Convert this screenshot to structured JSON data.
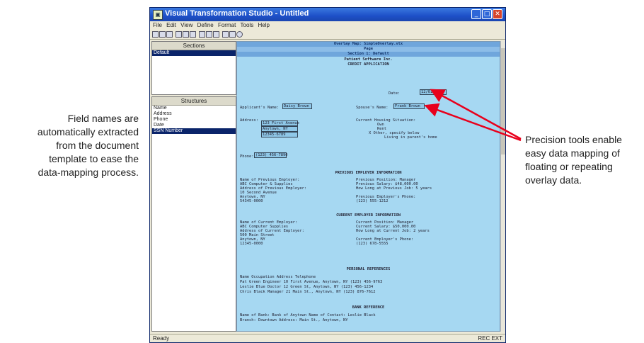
{
  "callouts": {
    "left": [
      "Field names are",
      "automatically extracted",
      "from the document",
      "template to ease the",
      "data-mapping process."
    ],
    "right": [
      "Precision tools enable",
      "easy data mapping of",
      "floating or repeating",
      "overlay data."
    ]
  },
  "window": {
    "title": "Visual Transformation Studio - Untitled",
    "menu": [
      "File",
      "Edit",
      "View",
      "Define",
      "Format",
      "Tools",
      "Help"
    ],
    "status_left": "Ready",
    "status_right": "REC  EXT"
  },
  "sections_pane": {
    "header": "Sections",
    "items": [
      "Default"
    ]
  },
  "structures_pane": {
    "header": "Structures",
    "items": [
      "Name",
      "Address",
      "Phone",
      "Date",
      "SSN Number"
    ],
    "selected": 4
  },
  "doc": {
    "headers": [
      "Overlay Map: SimpleOverlay.vtx",
      "Page",
      "Section 1: Default"
    ],
    "company": "Patient Software Inc.",
    "form_title": "CREDIT APPLICATION",
    "date_label": "Date:",
    "date_value": "12/01/2000",
    "applicant_label": "Applicant's Name:",
    "applicant_value": "Daisy Brown",
    "spouse_label": "Spouse's Name:",
    "spouse_value": "Frank Brown",
    "address_label": "Address:",
    "address_lines": [
      "123 First Avenue",
      "Anytown, NY",
      "12345-6789"
    ],
    "housing_label": "Current Housing Situation:",
    "housing_options": [
      "Own",
      "Rent",
      "X  Other, specify below",
      "Living in parent's home"
    ],
    "phone_label": "Phone:",
    "phone_value": "(123) 456-7890",
    "previous_title": "PREVIOUS EMPLOYER INFORMATION",
    "previous_left": [
      "Name of Previous Employer:",
      "   ABC Computer & Supplies",
      "Address of Previous Employer:",
      "   10 Second Avenue",
      "   Anytown, NY",
      "   54345-0000"
    ],
    "previous_right": [
      "Previous Position:       Manager",
      "Previous Salary:        $48,000.00",
      "How Long at Previous Job: 5 years",
      "",
      "Previous Employer's Phone:",
      "   (123) 555-1212"
    ],
    "current_title": "CURRENT EMPLOYER INFORMATION",
    "current_left": [
      "Name of Current Employer:",
      "   ABC Computer Supplies",
      "Address of Current Employer:",
      "   500 Main Street",
      "   Anytown, NY",
      "   12345-0000"
    ],
    "current_right": [
      "Current Position:         Manager",
      "Current Salary:        $50,000.00",
      "How Long at Current Job: 2 years",
      "",
      "Current Employer's Phone:",
      "   (123) 678-5555"
    ],
    "refs_title": "PERSONAL REFERENCES",
    "refs_rows": [
      "Name          Occupation    Address                    Telephone",
      "Pat Green     Engineer      10 First Avenue, Anytown, NY  (123) 456-9763",
      "Leslie Blue   Doctor        12 Green St, Anytown, NY      (123) 456-1234",
      "Chris Black   Manager       21 Main St., Anytown, NY      (123) 876-7612"
    ],
    "bank_title": "BANK REFERENCE",
    "bank_rows": [
      "Name of Bank:   Bank of Anytown           Name of Contact: Leslie Black",
      "Branch:         Downtown                  Address:         Main St., Anytown, NY"
    ]
  },
  "colors": {
    "doc_bg": "#a6d8f2",
    "titlebar": "#1e50c8",
    "arrow": "#e8001c",
    "selection": "#0a246a"
  }
}
